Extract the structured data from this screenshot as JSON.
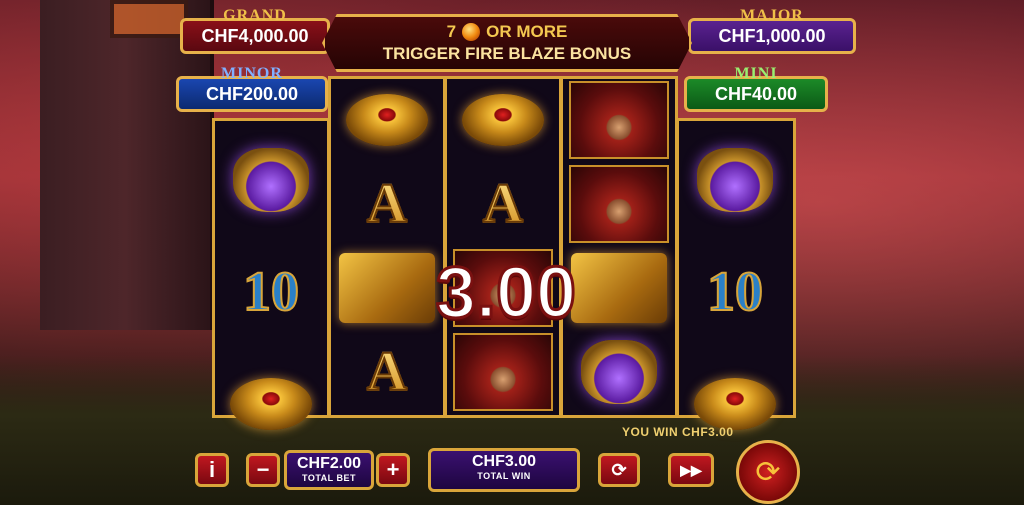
{
  "jackpots": {
    "grand": {
      "label": "GRAND",
      "value": "CHF4,000.00"
    },
    "major": {
      "label": "MAJOR",
      "value": "CHF1,000.00"
    },
    "minor": {
      "label": "MINOR",
      "value": "CHF200.00"
    },
    "mini": {
      "label": "MINI",
      "value": "CHF40.00"
    }
  },
  "banner": {
    "count": "7",
    "or_more": "OR MORE",
    "line2": "TRIGGER FIRE BLAZE BONUS"
  },
  "reels": [
    [
      "potion",
      "10",
      "ring"
    ],
    [
      "ring",
      "A",
      "book",
      "A"
    ],
    [
      "ring",
      "A",
      "wizard",
      "wizard"
    ],
    [
      "wizard",
      "wizard",
      "book",
      "potion"
    ],
    [
      "potion",
      "10",
      "ring"
    ]
  ],
  "win_amount": "3.00",
  "you_win": "YOU WIN CHF3.00",
  "controls": {
    "info": "i",
    "minus": "−",
    "plus": "+",
    "bet_value": "CHF2.00",
    "bet_label": "TOTAL BET",
    "win_value": "CHF3.00",
    "win_label": "TOTAL WIN",
    "autoplay_icon": "autoplay-icon",
    "turbo_icon": "turbo-icon",
    "spin_icon": "spin-icon"
  }
}
